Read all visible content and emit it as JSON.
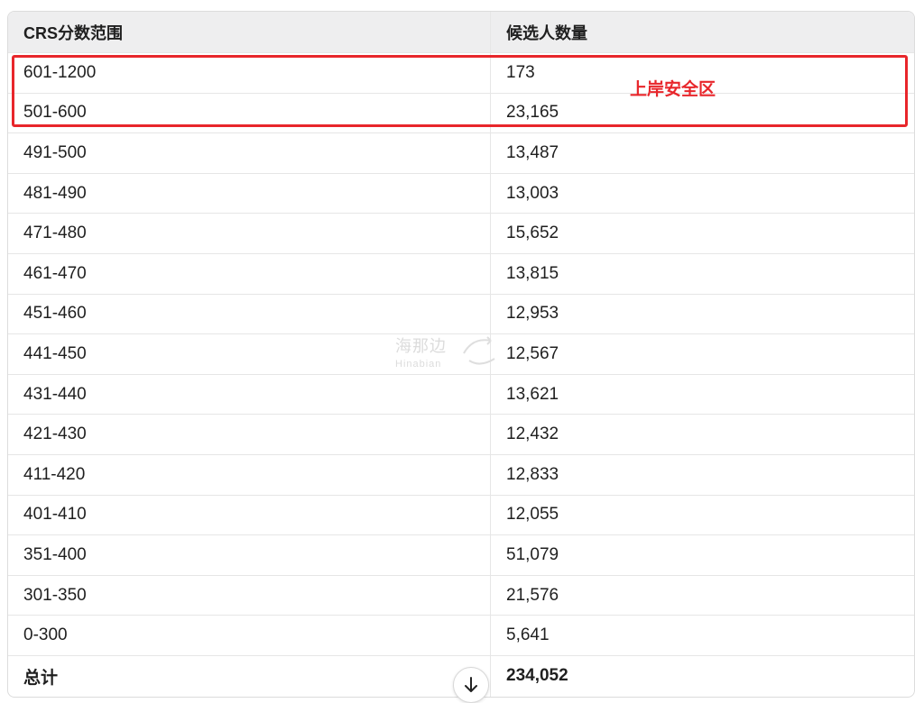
{
  "table": {
    "headers": [
      "CRS分数范围",
      "候选人数量"
    ],
    "rows": [
      [
        "601-1200",
        "173"
      ],
      [
        "501-600",
        "23,165"
      ],
      [
        "491-500",
        "13,487"
      ],
      [
        "481-490",
        "13,003"
      ],
      [
        "471-480",
        "15,652"
      ],
      [
        "461-470",
        "13,815"
      ],
      [
        "451-460",
        "12,953"
      ],
      [
        "441-450",
        "12,567"
      ],
      [
        "431-440",
        "13,621"
      ],
      [
        "421-430",
        "12,432"
      ],
      [
        "411-420",
        "12,833"
      ],
      [
        "401-410",
        "12,055"
      ],
      [
        "351-400",
        "51,079"
      ],
      [
        "301-350",
        "21,576"
      ],
      [
        "0-300",
        "5,641"
      ]
    ],
    "total": [
      "总计",
      "234,052"
    ]
  },
  "highlight": {
    "label": "上岸安全区",
    "color": "#e8262b"
  },
  "watermark": {
    "cn": "海那边",
    "en": "Hinabian"
  },
  "scroll_button": {
    "icon": "arrow-down-icon"
  }
}
